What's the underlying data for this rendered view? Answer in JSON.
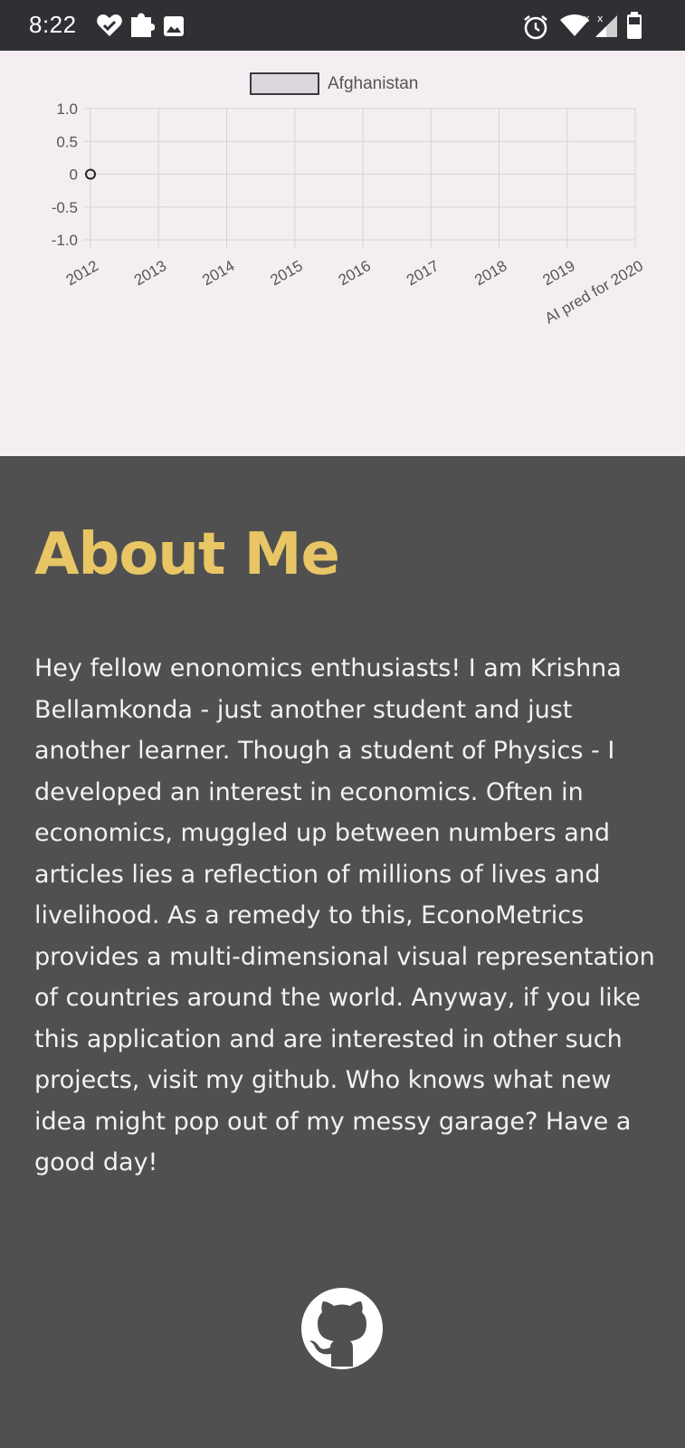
{
  "status_bar": {
    "time": "8:22",
    "icons": [
      "heart-check-icon",
      "puzzle-icon",
      "image-icon",
      "alarm-icon",
      "wifi-icon",
      "signal-icon",
      "battery-icon"
    ]
  },
  "chart_data": {
    "type": "line",
    "title": "",
    "xlabel": "",
    "ylabel": "",
    "categories": [
      "2012",
      "2013",
      "2014",
      "2015",
      "2016",
      "2017",
      "2018",
      "2019",
      "AI pred for 2020"
    ],
    "y_ticks": [
      "1.0",
      "0.5",
      "0",
      "-0.5",
      "-1.0"
    ],
    "ylim": [
      -1.0,
      1.0
    ],
    "grid": true,
    "legend_position": "top",
    "series": [
      {
        "name": "Afghanistan",
        "values": [
          0,
          null,
          null,
          null,
          null,
          null,
          null,
          null,
          null
        ]
      }
    ],
    "colors": {
      "point_stroke": "#222222",
      "legend_fill": "#ddd6dc",
      "grid": "#d8d2d6"
    }
  },
  "about": {
    "title": "About Me",
    "body": "Hey fellow enonomics enthusiasts! I am Krishna Bellamkonda - just another student and just another learner. Though a student of Physics - I developed an interest in economics. Often in economics, muggled up between numbers and articles lies a reflection of millions of lives and livelihood. As a remedy to this, EconoMetrics provides a multi-dimensional visual representation of countries around the world. Anyway, if you like this application and are interested in other such projects, visit my github. Who knows what new idea might pop out of my messy garage? Have a good day!",
    "github_icon": "github-icon"
  },
  "colors": {
    "status_bar_bg": "#2f3034",
    "chart_bg": "#f4eef2",
    "about_bg": "#505050",
    "accent": "#e8c665",
    "body_text": "#f2f2f2"
  }
}
